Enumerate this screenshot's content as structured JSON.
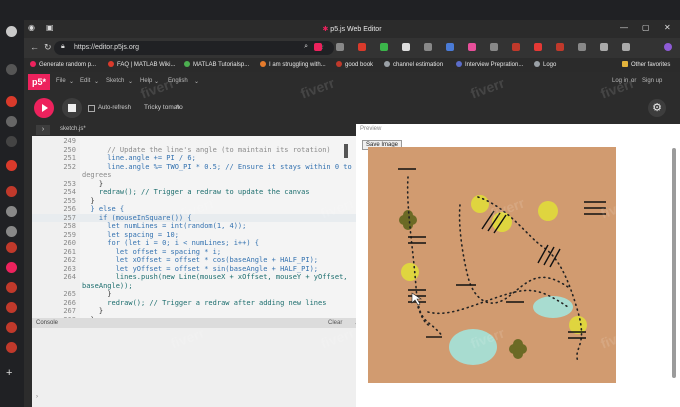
{
  "browser": {
    "title": "p5.js Web Editor",
    "url": "https://editor.p5js.org",
    "bookmarks": [
      {
        "label": "Generate random p...",
        "color": "#ed225d"
      },
      {
        "label": "FAQ | MATLAB Wiki...",
        "color": "#d93a2b"
      },
      {
        "label": "MATLAB Tutorialsp...",
        "color": "#4caf50"
      },
      {
        "label": "I am struggling with...",
        "color": "#e57b2c"
      },
      {
        "label": "good book",
        "color": "#c0392b"
      },
      {
        "label": "channel estimation",
        "color": "#9aa0a6"
      },
      {
        "label": "Interview Prepration...",
        "color": "#5b6cc9"
      },
      {
        "label": "Logo",
        "color": "#9aa0a6"
      }
    ],
    "other_favorites": "Other favorites"
  },
  "p5": {
    "logo": "p5*",
    "menu": [
      "File",
      "Edit",
      "Sketch",
      "Help",
      "English"
    ],
    "login": "Log in",
    "or": "or",
    "signup": "Sign up",
    "auto_refresh": "Auto-refresh",
    "sketch_name": "Tricky tomato",
    "file_tab": "sketch.js",
    "preview_label": "Preview",
    "save_image": "Save Image",
    "console_label": "Console",
    "clear_label": "Clear"
  },
  "code": {
    "lines": [
      {
        "n": "249",
        "t": "",
        "cls": ""
      },
      {
        "n": "250",
        "t": "      // Update the line's angle (to maintain its rotation)",
        "cls": "c"
      },
      {
        "n": "251",
        "t": "      line.angle += PI / 6;",
        "cls": "k"
      },
      {
        "n": "252",
        "t": "      line.angle %= TWO_PI * 0.5; // Ensure it stays within 0 to 180",
        "cls": "k"
      },
      {
        "n": "",
        "t": "degrees",
        "cls": "c"
      },
      {
        "n": "253",
        "t": "    }",
        "cls": ""
      },
      {
        "n": "254",
        "t": "    redraw(); // Trigger a redraw to update the canvas",
        "cls": "f"
      },
      {
        "n": "255",
        "t": "  }",
        "cls": ""
      },
      {
        "n": "256",
        "t": "  } else {",
        "cls": "k"
      },
      {
        "n": "257",
        "t": "    if (mouseInSquare()) {",
        "cls": "k"
      },
      {
        "n": "258",
        "t": "      let numLines = int(random(1, 4));",
        "cls": "k"
      },
      {
        "n": "259",
        "t": "      let spacing = 10;",
        "cls": "k"
      },
      {
        "n": "260",
        "t": "      for (let i = 0; i < numLines; i++) {",
        "cls": "k"
      },
      {
        "n": "261",
        "t": "        let offset = spacing * i;",
        "cls": "k"
      },
      {
        "n": "262",
        "t": "        let xOffset = offset * cos(baseAngle + HALF_PI);",
        "cls": "k"
      },
      {
        "n": "263",
        "t": "        let yOffset = offset * sin(baseAngle + HALF_PI);",
        "cls": "k"
      },
      {
        "n": "264",
        "t": "        lines.push(new Line(mouseX + xOffset, mouseY + yOffset,",
        "cls": "f"
      },
      {
        "n": "",
        "t": "baseAngle));",
        "cls": "f"
      },
      {
        "n": "265",
        "t": "      }",
        "cls": ""
      },
      {
        "n": "266",
        "t": "      redraw(); // Trigger a redraw after adding new lines",
        "cls": "f"
      },
      {
        "n": "267",
        "t": "    }",
        "cls": ""
      },
      {
        "n": "268",
        "t": "  }",
        "cls": ""
      }
    ]
  },
  "canvas_colors": {
    "background": "#d19b70",
    "blob": "#a8dcd0",
    "dot": "#e0dc3a",
    "flower": "#6b6a25"
  },
  "watermark": "fiverr"
}
